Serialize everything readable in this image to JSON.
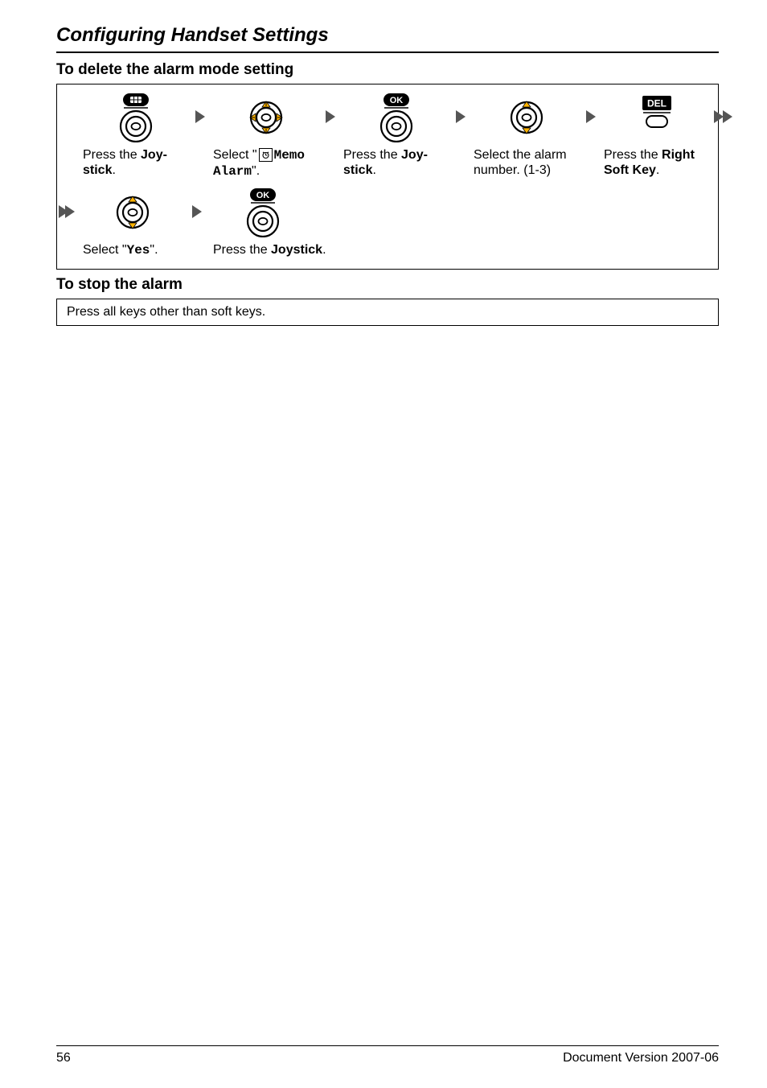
{
  "section_title": "Configuring Handset Settings",
  "sub_title_1": "To delete the alarm mode setting",
  "steps": {
    "s1": {
      "line1": "Press the ",
      "bold1": "Joy-",
      "line2": "stick",
      "tail": "."
    },
    "s2": {
      "prefix": "Select \"",
      "mono1": "Memo",
      "mono2": "Alarm",
      "suffix": "\"."
    },
    "s3": {
      "line1": "Press the ",
      "bold1": "Joy-",
      "line2": "stick",
      "tail": "."
    },
    "s4": {
      "line1": "Select the alarm",
      "line2": "number. (1-3)"
    },
    "s5": {
      "line1": "Press the ",
      "bold1": "Right",
      "line2": "Soft Key",
      "tail": "."
    },
    "s6": {
      "prefix": "Select \"",
      "mono": "Yes",
      "suffix": "\"."
    },
    "s7": {
      "line1": "Press the ",
      "bold1": "Joystick",
      "tail": "."
    }
  },
  "sub_title_2": "To stop the alarm",
  "note": "Press all keys other than soft keys.",
  "footer": {
    "page": "56",
    "version": "Document Version 2007-06"
  },
  "labels": {
    "ok": "OK",
    "del": "DEL"
  }
}
